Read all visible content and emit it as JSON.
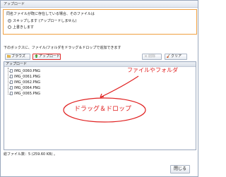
{
  "dialog": {
    "title": "アップロード"
  },
  "options": {
    "question": "同名ファイルが既に存在している場合、そのファイルは",
    "radios": [
      {
        "label": "スキップします (アップロードしません)",
        "selected": true
      },
      {
        "label": "上書きします",
        "selected": false
      }
    ]
  },
  "instruction": "下のボックスに、ファイル/フォルダをドラッグ＆ドロップで追加できます",
  "toolbar": {
    "browse_label": "ブラウズ",
    "upload_label": "アップロード",
    "delete_label": "削除",
    "clear_label": "クリア"
  },
  "list": {
    "header": "アップロード",
    "files": [
      "IMG_0060.PNG",
      "IMG_0061.PNG",
      "IMG_0062.PNG",
      "IMG_0064.PNG",
      "IMG_0065.PNG"
    ]
  },
  "annotations": {
    "file_or_folder": "ファイルやフォルダ",
    "drag_and_drop": "ドラッグ＆ドロップ",
    "color": "#e02020"
  },
  "status": "総ファイル数：5 (259.60 KB) 。",
  "close_label": "閉じる",
  "colors": {
    "upload_highlight": "#e03030",
    "options_border": "#f0a040"
  }
}
